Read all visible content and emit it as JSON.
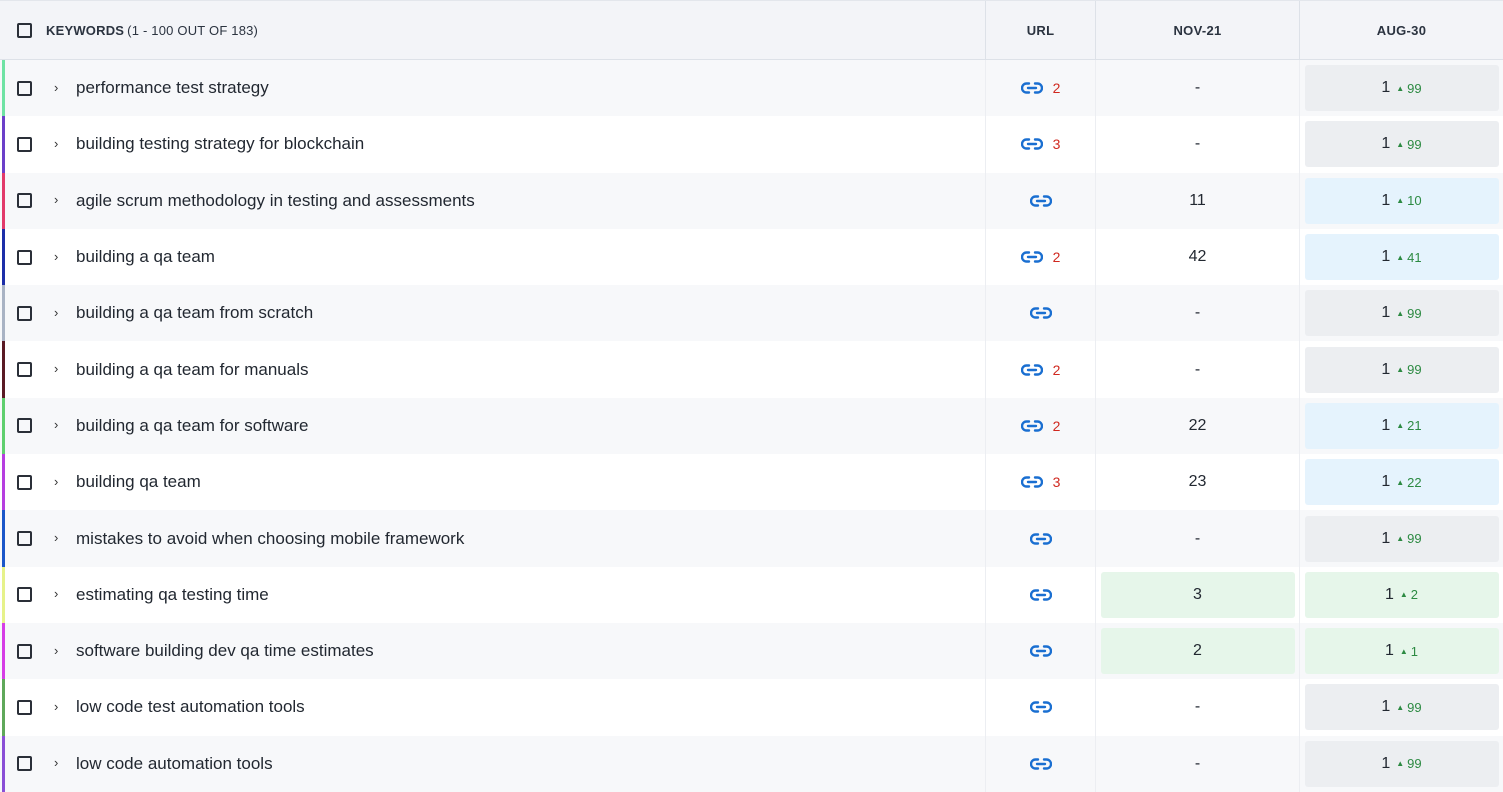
{
  "header": {
    "keywords_label": "KEYWORDS",
    "keywords_count": "(1 - 100 OUT OF 183)",
    "url_label": "URL",
    "nov_label": "NOV-21",
    "aug_label": "AUG-30"
  },
  "icons": {
    "link": "link-icon",
    "chevron": "chevron-right-icon",
    "up": "caret-up-icon"
  },
  "colors": {
    "url_count": "#d0281f",
    "delta_up": "#2c8a42",
    "link": "#1a6fd1"
  },
  "rows": [
    {
      "keyword": "performance test strategy",
      "bar_color": "#6fe3a4",
      "url_count": "2",
      "nov": "-",
      "aug": "1",
      "aug_delta": "99",
      "aug_box": "gray",
      "nov_box": "none"
    },
    {
      "keyword": "building testing strategy for blockchain",
      "bar_color": "#6b3fc9",
      "url_count": "3",
      "nov": "-",
      "aug": "1",
      "aug_delta": "99",
      "aug_box": "gray",
      "nov_box": "none"
    },
    {
      "keyword": "agile scrum methodology in testing and assessments",
      "bar_color": "#e23a6a",
      "url_count": "",
      "nov": "11",
      "aug": "1",
      "aug_delta": "10",
      "aug_box": "blue",
      "nov_box": "none"
    },
    {
      "keyword": "building a qa team",
      "bar_color": "#1d2ea8",
      "url_count": "2",
      "nov": "42",
      "aug": "1",
      "aug_delta": "41",
      "aug_box": "blue",
      "nov_box": "none"
    },
    {
      "keyword": "building a qa team from scratch",
      "bar_color": "#a9b3c4",
      "url_count": "",
      "nov": "-",
      "aug": "1",
      "aug_delta": "99",
      "aug_box": "gray",
      "nov_box": "none"
    },
    {
      "keyword": "building a qa team for manuals",
      "bar_color": "#5a1a24",
      "url_count": "2",
      "nov": "-",
      "aug": "1",
      "aug_delta": "99",
      "aug_box": "gray",
      "nov_box": "none"
    },
    {
      "keyword": "building a qa team for software",
      "bar_color": "#5fcf6e",
      "url_count": "2",
      "nov": "22",
      "aug": "1",
      "aug_delta": "21",
      "aug_box": "blue",
      "nov_box": "none"
    },
    {
      "keyword": "building qa team",
      "bar_color": "#b63ee0",
      "url_count": "3",
      "nov": "23",
      "aug": "1",
      "aug_delta": "22",
      "aug_box": "blue",
      "nov_box": "none"
    },
    {
      "keyword": "mistakes to avoid when choosing mobile framework",
      "bar_color": "#1a56c9",
      "url_count": "",
      "nov": "-",
      "aug": "1",
      "aug_delta": "99",
      "aug_box": "gray",
      "nov_box": "none"
    },
    {
      "keyword": "estimating qa testing time",
      "bar_color": "#e6f28a",
      "url_count": "",
      "nov": "3",
      "aug": "1",
      "aug_delta": "2",
      "aug_box": "green",
      "nov_box": "green"
    },
    {
      "keyword": "software building dev qa time estimates",
      "bar_color": "#d63de6",
      "url_count": "",
      "nov": "2",
      "aug": "1",
      "aug_delta": "1",
      "aug_box": "green",
      "nov_box": "green"
    },
    {
      "keyword": "low code test automation tools",
      "bar_color": "#5fa85a",
      "url_count": "",
      "nov": "-",
      "aug": "1",
      "aug_delta": "99",
      "aug_box": "gray",
      "nov_box": "none"
    },
    {
      "keyword": "low code automation tools",
      "bar_color": "#8a4fd6",
      "url_count": "",
      "nov": "-",
      "aug": "1",
      "aug_delta": "99",
      "aug_box": "gray",
      "nov_box": "none"
    }
  ]
}
